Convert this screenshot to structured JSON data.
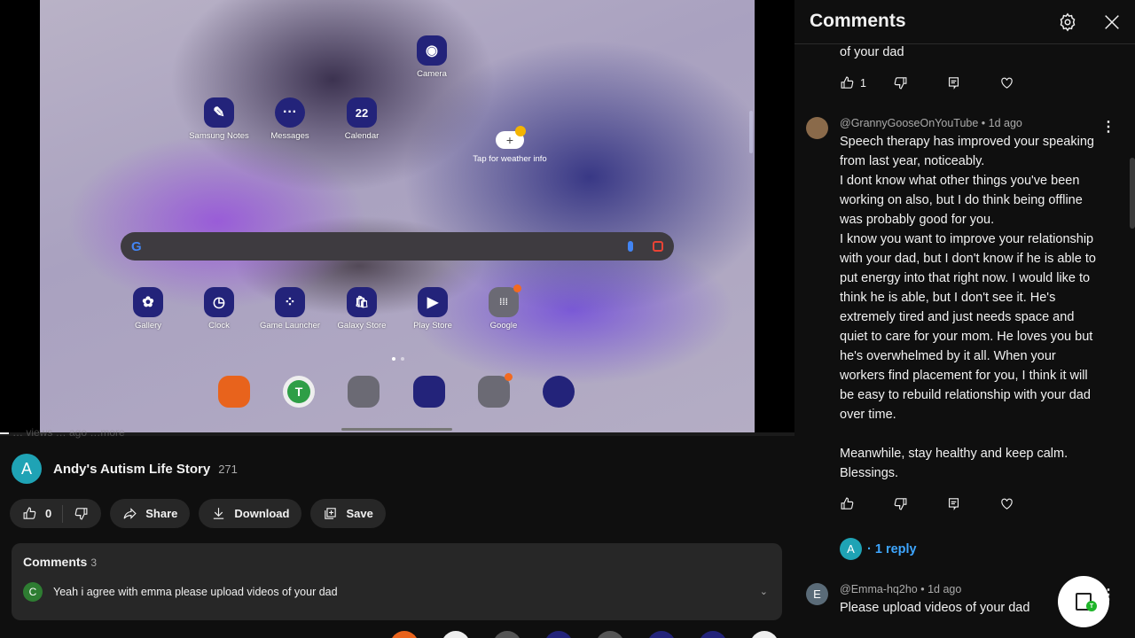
{
  "video": {
    "home_screen": {
      "apps_top": [
        {
          "label": "Camera",
          "icon": "camera-icon",
          "glyph": "◉"
        },
        {
          "label": "Samsung Notes",
          "icon": "notes-icon",
          "glyph": "✎"
        },
        {
          "label": "Messages",
          "icon": "messages-icon",
          "glyph": "···"
        },
        {
          "label": "Calendar",
          "icon": "calendar-icon",
          "glyph": "22"
        }
      ],
      "weather_widget": {
        "label": "Tap for weather info",
        "glyph": "+"
      },
      "search_bar": {
        "logo": "G"
      },
      "apps_row": [
        {
          "label": "Gallery",
          "icon": "gallery-icon",
          "glyph": "✿"
        },
        {
          "label": "Clock",
          "icon": "clock-icon",
          "glyph": "◷"
        },
        {
          "label": "Game Launcher",
          "icon": "game-launcher-icon",
          "glyph": "⁘"
        },
        {
          "label": "Galaxy Store",
          "icon": "galaxy-store-icon",
          "glyph": "🛍"
        },
        {
          "label": "Play Store",
          "icon": "play-store-icon",
          "glyph": "▶"
        },
        {
          "label": "Google",
          "icon": "google-folder-icon",
          "glyph": "⁞⁞⁞"
        }
      ],
      "dock_glyphs": {
        "texting_app": "T"
      }
    },
    "meta_partial": "… views  … ago  …more"
  },
  "channel": {
    "avatar_letter": "A",
    "name": "Andy's Autism Life Story",
    "subscribers": "271"
  },
  "actions": {
    "like_count": "0",
    "share_label": "Share",
    "download_label": "Download",
    "save_label": "Save"
  },
  "comments_card": {
    "title": "Comments",
    "count": "3",
    "preview_avatar": "C",
    "preview_text": "Yeah i agree with emma please upload videos of your dad",
    "expand_glyph": "⌄"
  },
  "panel": {
    "title": "Comments",
    "prev_comment": {
      "tail_text": "of your dad",
      "like_count": "1"
    },
    "comment1": {
      "author": "@GrannyGooseOnYouTube",
      "time": "1d ago",
      "body": [
        "Speech therapy has improved your speaking",
        "from last year, noticeably.",
        "I dont know what other things you've been",
        "working on also, but I do think being offline",
        "was probably good for you.",
        "I know you want to improve your relationship",
        "with your dad, but I don't know if he is able to",
        "put energy into that right now. I would like to",
        "think he is able, but I don't see it. He's",
        "extremely tired and just needs space and",
        "quiet to care for your mom. He loves you but",
        "he's overwhelmed by it all. When your",
        "workers find placement for you, I think it will",
        "be easy to rebuild relationship with your dad",
        "over time.",
        "",
        "Meanwhile, stay healthy and keep calm.",
        "Blessings."
      ],
      "reply_avatar": "A",
      "reply_label": "· 1 reply"
    },
    "comment2": {
      "avatar_letter": "E",
      "author": "@Emma-hq2ho",
      "time": "1d ago",
      "body": "Please upload videos of your dad"
    },
    "fab_badge": "T"
  },
  "colors": {
    "accent_link": "#3ea6ff",
    "channel_avatar": "#1fa3b5",
    "commenter_c": "#2e7d32",
    "commenter_e": "#5a6b78",
    "app_icon_bg": "#23237a"
  }
}
